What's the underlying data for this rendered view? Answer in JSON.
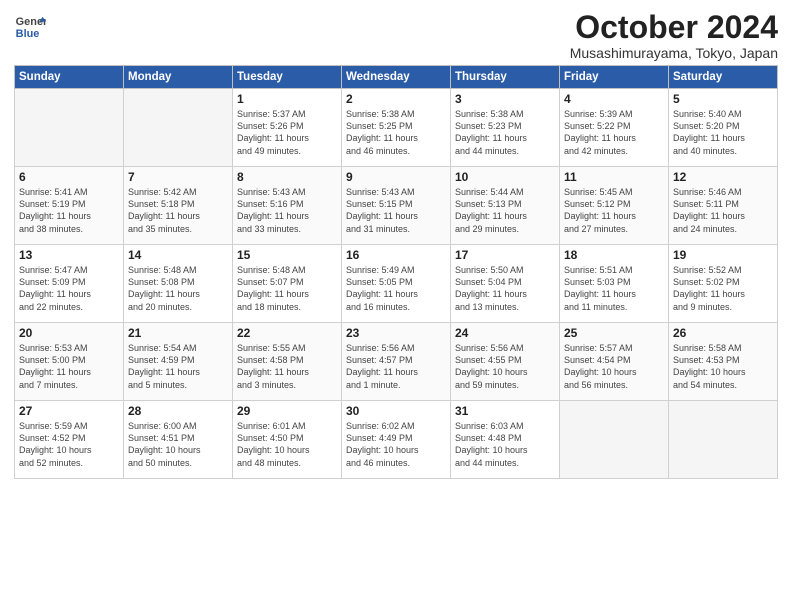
{
  "header": {
    "logo_line1": "General",
    "logo_line2": "Blue",
    "month_title": "October 2024",
    "location": "Musashimurayama, Tokyo, Japan"
  },
  "weekdays": [
    "Sunday",
    "Monday",
    "Tuesday",
    "Wednesday",
    "Thursday",
    "Friday",
    "Saturday"
  ],
  "weeks": [
    [
      {
        "day": "",
        "info": ""
      },
      {
        "day": "",
        "info": ""
      },
      {
        "day": "1",
        "info": "Sunrise: 5:37 AM\nSunset: 5:26 PM\nDaylight: 11 hours\nand 49 minutes."
      },
      {
        "day": "2",
        "info": "Sunrise: 5:38 AM\nSunset: 5:25 PM\nDaylight: 11 hours\nand 46 minutes."
      },
      {
        "day": "3",
        "info": "Sunrise: 5:38 AM\nSunset: 5:23 PM\nDaylight: 11 hours\nand 44 minutes."
      },
      {
        "day": "4",
        "info": "Sunrise: 5:39 AM\nSunset: 5:22 PM\nDaylight: 11 hours\nand 42 minutes."
      },
      {
        "day": "5",
        "info": "Sunrise: 5:40 AM\nSunset: 5:20 PM\nDaylight: 11 hours\nand 40 minutes."
      }
    ],
    [
      {
        "day": "6",
        "info": "Sunrise: 5:41 AM\nSunset: 5:19 PM\nDaylight: 11 hours\nand 38 minutes."
      },
      {
        "day": "7",
        "info": "Sunrise: 5:42 AM\nSunset: 5:18 PM\nDaylight: 11 hours\nand 35 minutes."
      },
      {
        "day": "8",
        "info": "Sunrise: 5:43 AM\nSunset: 5:16 PM\nDaylight: 11 hours\nand 33 minutes."
      },
      {
        "day": "9",
        "info": "Sunrise: 5:43 AM\nSunset: 5:15 PM\nDaylight: 11 hours\nand 31 minutes."
      },
      {
        "day": "10",
        "info": "Sunrise: 5:44 AM\nSunset: 5:13 PM\nDaylight: 11 hours\nand 29 minutes."
      },
      {
        "day": "11",
        "info": "Sunrise: 5:45 AM\nSunset: 5:12 PM\nDaylight: 11 hours\nand 27 minutes."
      },
      {
        "day": "12",
        "info": "Sunrise: 5:46 AM\nSunset: 5:11 PM\nDaylight: 11 hours\nand 24 minutes."
      }
    ],
    [
      {
        "day": "13",
        "info": "Sunrise: 5:47 AM\nSunset: 5:09 PM\nDaylight: 11 hours\nand 22 minutes."
      },
      {
        "day": "14",
        "info": "Sunrise: 5:48 AM\nSunset: 5:08 PM\nDaylight: 11 hours\nand 20 minutes."
      },
      {
        "day": "15",
        "info": "Sunrise: 5:48 AM\nSunset: 5:07 PM\nDaylight: 11 hours\nand 18 minutes."
      },
      {
        "day": "16",
        "info": "Sunrise: 5:49 AM\nSunset: 5:05 PM\nDaylight: 11 hours\nand 16 minutes."
      },
      {
        "day": "17",
        "info": "Sunrise: 5:50 AM\nSunset: 5:04 PM\nDaylight: 11 hours\nand 13 minutes."
      },
      {
        "day": "18",
        "info": "Sunrise: 5:51 AM\nSunset: 5:03 PM\nDaylight: 11 hours\nand 11 minutes."
      },
      {
        "day": "19",
        "info": "Sunrise: 5:52 AM\nSunset: 5:02 PM\nDaylight: 11 hours\nand 9 minutes."
      }
    ],
    [
      {
        "day": "20",
        "info": "Sunrise: 5:53 AM\nSunset: 5:00 PM\nDaylight: 11 hours\nand 7 minutes."
      },
      {
        "day": "21",
        "info": "Sunrise: 5:54 AM\nSunset: 4:59 PM\nDaylight: 11 hours\nand 5 minutes."
      },
      {
        "day": "22",
        "info": "Sunrise: 5:55 AM\nSunset: 4:58 PM\nDaylight: 11 hours\nand 3 minutes."
      },
      {
        "day": "23",
        "info": "Sunrise: 5:56 AM\nSunset: 4:57 PM\nDaylight: 11 hours\nand 1 minute."
      },
      {
        "day": "24",
        "info": "Sunrise: 5:56 AM\nSunset: 4:55 PM\nDaylight: 10 hours\nand 59 minutes."
      },
      {
        "day": "25",
        "info": "Sunrise: 5:57 AM\nSunset: 4:54 PM\nDaylight: 10 hours\nand 56 minutes."
      },
      {
        "day": "26",
        "info": "Sunrise: 5:58 AM\nSunset: 4:53 PM\nDaylight: 10 hours\nand 54 minutes."
      }
    ],
    [
      {
        "day": "27",
        "info": "Sunrise: 5:59 AM\nSunset: 4:52 PM\nDaylight: 10 hours\nand 52 minutes."
      },
      {
        "day": "28",
        "info": "Sunrise: 6:00 AM\nSunset: 4:51 PM\nDaylight: 10 hours\nand 50 minutes."
      },
      {
        "day": "29",
        "info": "Sunrise: 6:01 AM\nSunset: 4:50 PM\nDaylight: 10 hours\nand 48 minutes."
      },
      {
        "day": "30",
        "info": "Sunrise: 6:02 AM\nSunset: 4:49 PM\nDaylight: 10 hours\nand 46 minutes."
      },
      {
        "day": "31",
        "info": "Sunrise: 6:03 AM\nSunset: 4:48 PM\nDaylight: 10 hours\nand 44 minutes."
      },
      {
        "day": "",
        "info": ""
      },
      {
        "day": "",
        "info": ""
      }
    ]
  ]
}
